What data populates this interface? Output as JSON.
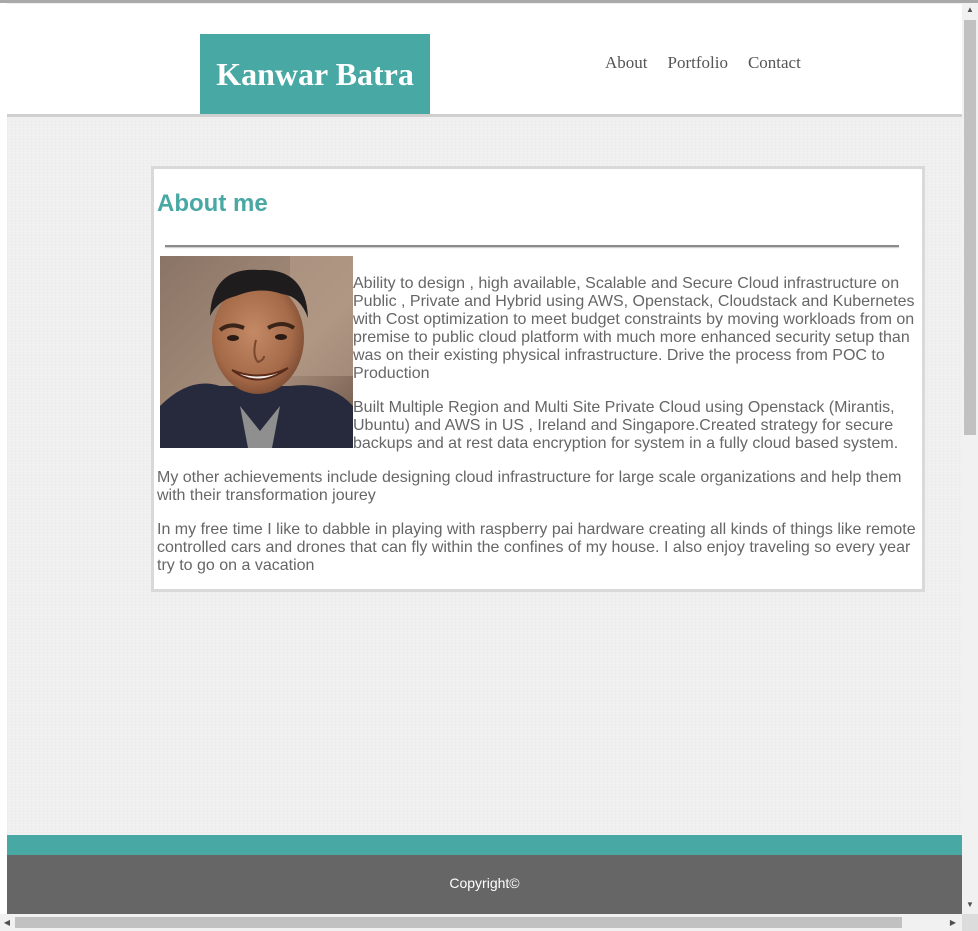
{
  "header": {
    "logo_text": "Kanwar Batra",
    "nav": [
      "About",
      "Portfolio",
      "Contact"
    ]
  },
  "about": {
    "heading": "About me",
    "photo": "profile-photo",
    "paragraphs": [
      "Ability to design , high available, Scalable and Secure Cloud infrastructure on Public , Private and Hybrid using AWS, Openstack, Cloudstack and Kubernetes with Cost optimization to meet budget constraints by moving workloads from on premise to public cloud platform with much more enhanced security setup than was on their existing physical infrastructure. Drive the process from POC to Production",
      "Built Multiple Region and Multi Site Private Cloud using Openstack (Mirantis, Ubuntu) and AWS in US , Ireland and Singapore.Created strategy for secure backups and at rest data encryption for system in a fully cloud based system.",
      "My other achievements include designing cloud infrastructure for large scale organizations and help them with their transformation jourey",
      "In my free time I like to dabble in playing with raspberry pai hardware creating all kinds of things like remote controlled cars and drones that can fly within the confines of my house. I also enjoy traveling so every year try to go on a vacation"
    ]
  },
  "footer": {
    "copyright": "Copyright©"
  },
  "colors": {
    "accent": "#48a8a3",
    "footer_bg": "#666666",
    "text": "#666666"
  }
}
